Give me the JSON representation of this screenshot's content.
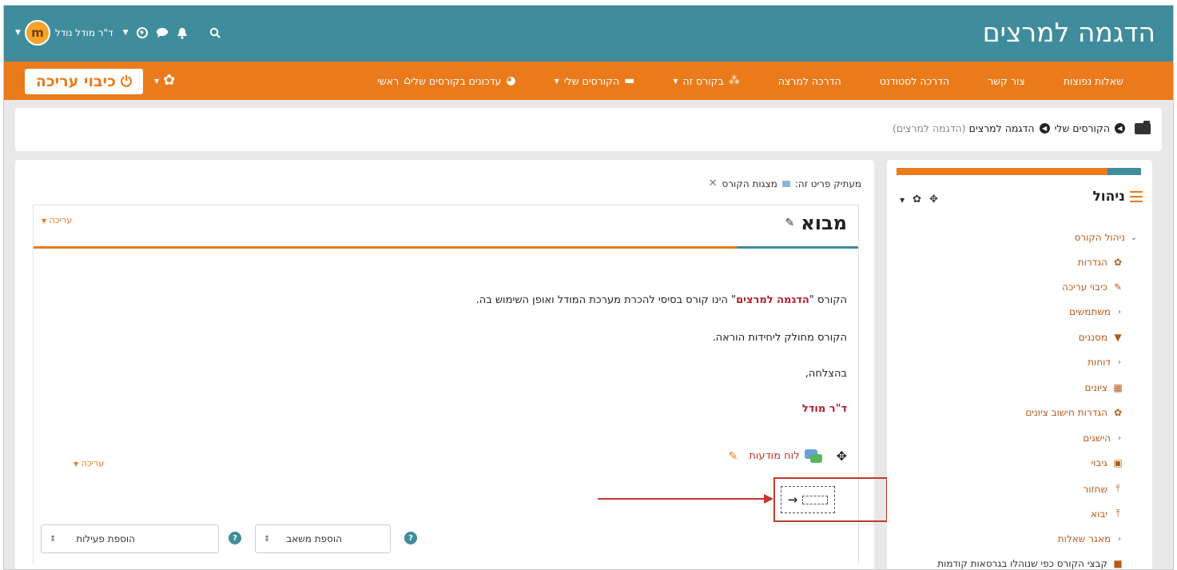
{
  "header": {
    "site_title": "הדגמה למרצים",
    "user_name": "ד\"ר מודל נודל",
    "avatar_text": "m"
  },
  "nav": {
    "items": [
      {
        "label": "ראשי",
        "icon": "home-icon",
        "caret": false
      },
      {
        "label": "עדכונים בקורסים שלי",
        "icon": "dashboard-icon",
        "caret": false
      },
      {
        "label": "הקורסים שלי",
        "icon": "briefcase-icon",
        "caret": true
      },
      {
        "label": "בקורס זה",
        "icon": "sitemap-icon",
        "caret": true
      },
      {
        "label": "הדרכה למרצה",
        "icon": "",
        "caret": false
      },
      {
        "label": "הדרכה לסטודנט",
        "icon": "",
        "caret": false
      },
      {
        "label": "צור קשר",
        "icon": "",
        "caret": false
      },
      {
        "label": "שאלות נפוצות",
        "icon": "",
        "caret": false
      }
    ],
    "edit_button": "כיבוי עריכה"
  },
  "breadcrumb": {
    "items": [
      "הקורסים שלי",
      "הדגמה למרצים"
    ],
    "suffix": "(הדגמה למרצים)"
  },
  "main": {
    "copy_prefix": "מעתיק פריט זה:",
    "copy_item": "מצגות הקורס",
    "section_title": "מבוא",
    "section_edit": "עריכה",
    "summary": {
      "line1_a": "הקורס \"",
      "line1_course": "הדגמה למרצים",
      "line1_b": "\" הינו קורס בסיסי להכרת מערכת המודל ואופן השימוש בה.",
      "line2": "הקורס מחולק ליחידות הוראה.",
      "line3": "בהצלחה,",
      "signature": "ד\"ר מודל"
    },
    "activity_name": "לוח מודעות",
    "activity_edit": "עריכה",
    "add_resource": "הוספת משאב",
    "add_activity": "הוספת פעילות"
  },
  "admin_block": {
    "title": "ניהול",
    "items": [
      {
        "label": "ניהול הקורס",
        "kind": "expanded",
        "icon": "",
        "indent": 0
      },
      {
        "label": "הגדרות",
        "kind": "icon",
        "icon": "✿",
        "indent": 1
      },
      {
        "label": "כיבוי עריכה",
        "kind": "icon",
        "icon": "✎",
        "indent": 1
      },
      {
        "label": "משתמשים",
        "kind": "collapsed",
        "icon": "",
        "indent": 1
      },
      {
        "label": "מסננים",
        "kind": "icon",
        "icon": "▼",
        "indent": 1
      },
      {
        "label": "דוחות",
        "kind": "collapsed",
        "icon": "",
        "indent": 1
      },
      {
        "label": "ציונים",
        "kind": "icon",
        "icon": "▦",
        "indent": 1
      },
      {
        "label": "הגדרות חישוב ציונים",
        "kind": "icon",
        "icon": "✿",
        "indent": 1
      },
      {
        "label": "הישגים",
        "kind": "collapsed",
        "icon": "",
        "indent": 1
      },
      {
        "label": "גיבוי",
        "kind": "icon",
        "icon": "▣",
        "indent": 1
      },
      {
        "label": "שחזור",
        "kind": "icon",
        "icon": "⤒",
        "indent": 1
      },
      {
        "label": "יבוא",
        "kind": "icon",
        "icon": "⤒",
        "indent": 1
      },
      {
        "label": "מאגר שאלות",
        "kind": "collapsed",
        "icon": "",
        "indent": 1
      },
      {
        "label": "קבצי הקורס כפי שנוהלו בגרסאות קודמות",
        "kind": "icon",
        "icon": "■",
        "indent": 1
      }
    ]
  },
  "colors": {
    "teal": "#3f8c9c",
    "orange": "#ea7a1a",
    "link_red": "#b11f2a"
  }
}
